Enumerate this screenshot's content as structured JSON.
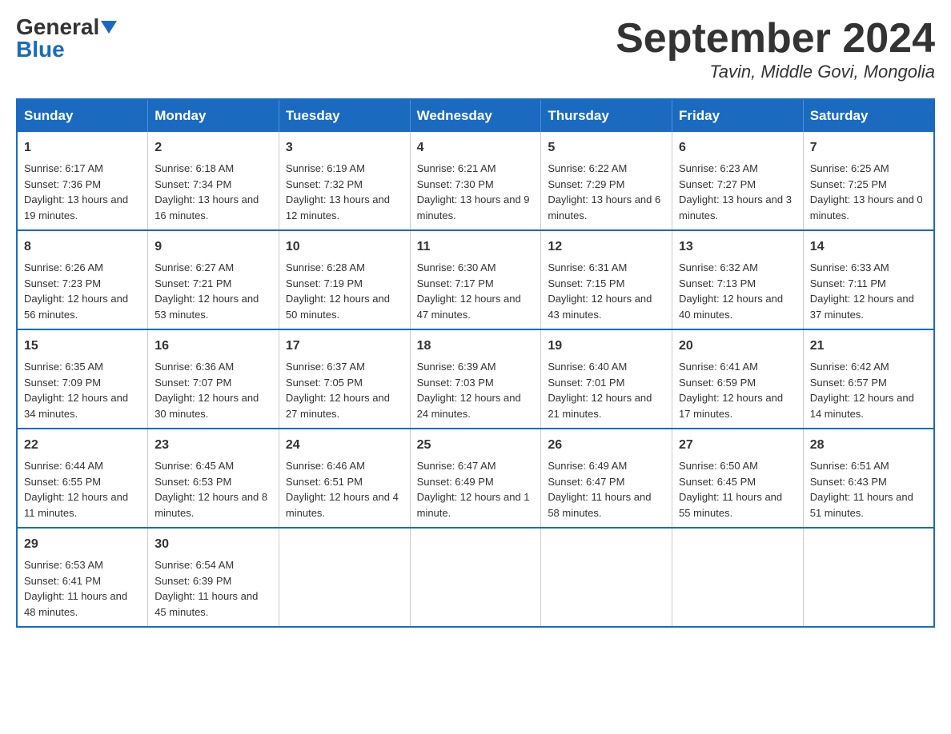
{
  "header": {
    "logo_general": "General",
    "logo_blue": "Blue",
    "month_title": "September 2024",
    "location": "Tavin, Middle Govi, Mongolia"
  },
  "days_of_week": [
    "Sunday",
    "Monday",
    "Tuesday",
    "Wednesday",
    "Thursday",
    "Friday",
    "Saturday"
  ],
  "weeks": [
    [
      {
        "day": "1",
        "sunrise": "Sunrise: 6:17 AM",
        "sunset": "Sunset: 7:36 PM",
        "daylight": "Daylight: 13 hours and 19 minutes."
      },
      {
        "day": "2",
        "sunrise": "Sunrise: 6:18 AM",
        "sunset": "Sunset: 7:34 PM",
        "daylight": "Daylight: 13 hours and 16 minutes."
      },
      {
        "day": "3",
        "sunrise": "Sunrise: 6:19 AM",
        "sunset": "Sunset: 7:32 PM",
        "daylight": "Daylight: 13 hours and 12 minutes."
      },
      {
        "day": "4",
        "sunrise": "Sunrise: 6:21 AM",
        "sunset": "Sunset: 7:30 PM",
        "daylight": "Daylight: 13 hours and 9 minutes."
      },
      {
        "day": "5",
        "sunrise": "Sunrise: 6:22 AM",
        "sunset": "Sunset: 7:29 PM",
        "daylight": "Daylight: 13 hours and 6 minutes."
      },
      {
        "day": "6",
        "sunrise": "Sunrise: 6:23 AM",
        "sunset": "Sunset: 7:27 PM",
        "daylight": "Daylight: 13 hours and 3 minutes."
      },
      {
        "day": "7",
        "sunrise": "Sunrise: 6:25 AM",
        "sunset": "Sunset: 7:25 PM",
        "daylight": "Daylight: 13 hours and 0 minutes."
      }
    ],
    [
      {
        "day": "8",
        "sunrise": "Sunrise: 6:26 AM",
        "sunset": "Sunset: 7:23 PM",
        "daylight": "Daylight: 12 hours and 56 minutes."
      },
      {
        "day": "9",
        "sunrise": "Sunrise: 6:27 AM",
        "sunset": "Sunset: 7:21 PM",
        "daylight": "Daylight: 12 hours and 53 minutes."
      },
      {
        "day": "10",
        "sunrise": "Sunrise: 6:28 AM",
        "sunset": "Sunset: 7:19 PM",
        "daylight": "Daylight: 12 hours and 50 minutes."
      },
      {
        "day": "11",
        "sunrise": "Sunrise: 6:30 AM",
        "sunset": "Sunset: 7:17 PM",
        "daylight": "Daylight: 12 hours and 47 minutes."
      },
      {
        "day": "12",
        "sunrise": "Sunrise: 6:31 AM",
        "sunset": "Sunset: 7:15 PM",
        "daylight": "Daylight: 12 hours and 43 minutes."
      },
      {
        "day": "13",
        "sunrise": "Sunrise: 6:32 AM",
        "sunset": "Sunset: 7:13 PM",
        "daylight": "Daylight: 12 hours and 40 minutes."
      },
      {
        "day": "14",
        "sunrise": "Sunrise: 6:33 AM",
        "sunset": "Sunset: 7:11 PM",
        "daylight": "Daylight: 12 hours and 37 minutes."
      }
    ],
    [
      {
        "day": "15",
        "sunrise": "Sunrise: 6:35 AM",
        "sunset": "Sunset: 7:09 PM",
        "daylight": "Daylight: 12 hours and 34 minutes."
      },
      {
        "day": "16",
        "sunrise": "Sunrise: 6:36 AM",
        "sunset": "Sunset: 7:07 PM",
        "daylight": "Daylight: 12 hours and 30 minutes."
      },
      {
        "day": "17",
        "sunrise": "Sunrise: 6:37 AM",
        "sunset": "Sunset: 7:05 PM",
        "daylight": "Daylight: 12 hours and 27 minutes."
      },
      {
        "day": "18",
        "sunrise": "Sunrise: 6:39 AM",
        "sunset": "Sunset: 7:03 PM",
        "daylight": "Daylight: 12 hours and 24 minutes."
      },
      {
        "day": "19",
        "sunrise": "Sunrise: 6:40 AM",
        "sunset": "Sunset: 7:01 PM",
        "daylight": "Daylight: 12 hours and 21 minutes."
      },
      {
        "day": "20",
        "sunrise": "Sunrise: 6:41 AM",
        "sunset": "Sunset: 6:59 PM",
        "daylight": "Daylight: 12 hours and 17 minutes."
      },
      {
        "day": "21",
        "sunrise": "Sunrise: 6:42 AM",
        "sunset": "Sunset: 6:57 PM",
        "daylight": "Daylight: 12 hours and 14 minutes."
      }
    ],
    [
      {
        "day": "22",
        "sunrise": "Sunrise: 6:44 AM",
        "sunset": "Sunset: 6:55 PM",
        "daylight": "Daylight: 12 hours and 11 minutes."
      },
      {
        "day": "23",
        "sunrise": "Sunrise: 6:45 AM",
        "sunset": "Sunset: 6:53 PM",
        "daylight": "Daylight: 12 hours and 8 minutes."
      },
      {
        "day": "24",
        "sunrise": "Sunrise: 6:46 AM",
        "sunset": "Sunset: 6:51 PM",
        "daylight": "Daylight: 12 hours and 4 minutes."
      },
      {
        "day": "25",
        "sunrise": "Sunrise: 6:47 AM",
        "sunset": "Sunset: 6:49 PM",
        "daylight": "Daylight: 12 hours and 1 minute."
      },
      {
        "day": "26",
        "sunrise": "Sunrise: 6:49 AM",
        "sunset": "Sunset: 6:47 PM",
        "daylight": "Daylight: 11 hours and 58 minutes."
      },
      {
        "day": "27",
        "sunrise": "Sunrise: 6:50 AM",
        "sunset": "Sunset: 6:45 PM",
        "daylight": "Daylight: 11 hours and 55 minutes."
      },
      {
        "day": "28",
        "sunrise": "Sunrise: 6:51 AM",
        "sunset": "Sunset: 6:43 PM",
        "daylight": "Daylight: 11 hours and 51 minutes."
      }
    ],
    [
      {
        "day": "29",
        "sunrise": "Sunrise: 6:53 AM",
        "sunset": "Sunset: 6:41 PM",
        "daylight": "Daylight: 11 hours and 48 minutes."
      },
      {
        "day": "30",
        "sunrise": "Sunrise: 6:54 AM",
        "sunset": "Sunset: 6:39 PM",
        "daylight": "Daylight: 11 hours and 45 minutes."
      },
      null,
      null,
      null,
      null,
      null
    ]
  ]
}
